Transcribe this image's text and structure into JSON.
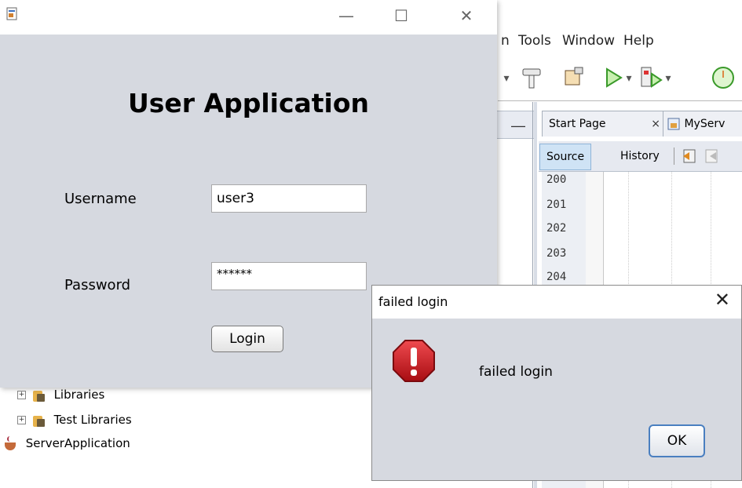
{
  "ide": {
    "menu": [
      "n",
      "Tools",
      "Window",
      "Help"
    ],
    "editor_tabs": [
      {
        "label": "Start Page",
        "close": "×"
      },
      {
        "label": "MyServ"
      }
    ],
    "source_label": "Source",
    "history_label": "History",
    "line_numbers": [
      "200",
      "201",
      "202",
      "203",
      "204"
    ],
    "tree": [
      {
        "label": "Libraries",
        "expander": "+"
      },
      {
        "label": "Test Libraries",
        "expander": "+"
      },
      {
        "label": "ServerApplication"
      }
    ],
    "panel_minimize": "—"
  },
  "app_window": {
    "window_controls": {
      "minimize": "—",
      "maximize": "☐",
      "close": "✕"
    },
    "title": "User Application",
    "username_label": "Username",
    "username_value": "user3",
    "password_label": "Password",
    "password_value": "******",
    "login_label": "Login"
  },
  "dialog": {
    "title": "failed login",
    "close": "✕",
    "message": "failed login",
    "ok_label": "OK",
    "icon": "error-icon"
  },
  "colors": {
    "window_bg": "#d6d9e0",
    "error_red": "#c8161d",
    "ok_border": "#4a7fc0"
  }
}
